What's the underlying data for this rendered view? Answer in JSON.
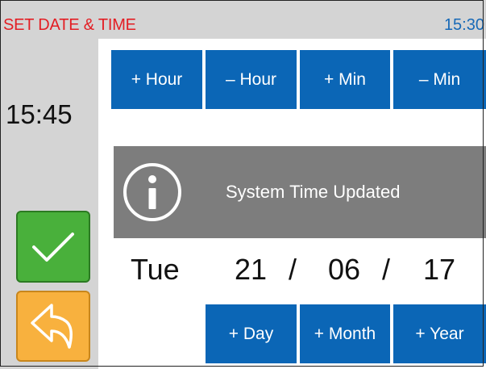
{
  "header": {
    "title": "SET DATE & TIME",
    "time": "15:30"
  },
  "sidebar": {
    "current_time": "15:45",
    "confirm_icon": "checkmark-icon",
    "back_icon": "back-arrow-icon"
  },
  "time_buttons": {
    "hour_plus": "+ Hour",
    "hour_minus": "– Hour",
    "min_plus": "+ Min",
    "min_minus": "– Min"
  },
  "notification": {
    "message": "System Time Updated",
    "icon": "info-icon"
  },
  "date": {
    "weekday": "Tue",
    "day": "21",
    "month": "06",
    "year": "17",
    "separator": "/"
  },
  "date_buttons": {
    "day_plus": "+ Day",
    "month_plus": "+ Month",
    "year_plus": "+ Year"
  },
  "colors": {
    "title": "#e31e24",
    "header_time": "#1769b7",
    "button": "#0b66b6",
    "confirm": "#49b03b",
    "back": "#f8b13e",
    "banner": "#7d7d7d"
  }
}
